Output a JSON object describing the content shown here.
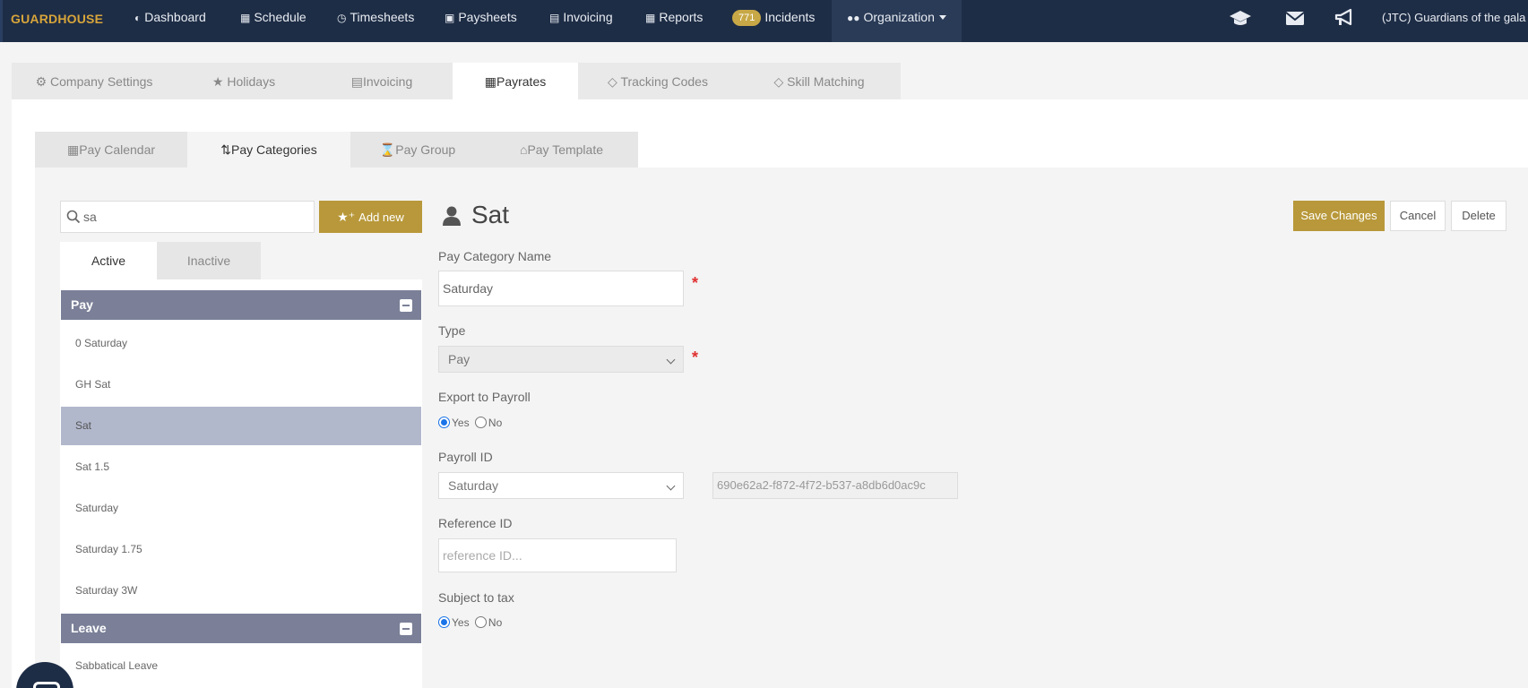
{
  "navbar": {
    "brand": "GUARDHOUSE",
    "items": [
      {
        "label": "Dashboard",
        "icon": "tachometer-icon",
        "glyph": "🚗"
      },
      {
        "label": "Schedule",
        "icon": "calendar-icon",
        "glyph": "▦"
      },
      {
        "label": "Timesheets",
        "icon": "clock-icon",
        "glyph": "◷"
      },
      {
        "label": "Paysheets",
        "icon": "money-icon",
        "glyph": "▣"
      },
      {
        "label": "Invoicing",
        "icon": "invoice-icon",
        "glyph": "▤"
      },
      {
        "label": "Reports",
        "icon": "table-icon",
        "glyph": "▦"
      },
      {
        "label": "Incidents",
        "badge": "771"
      },
      {
        "label": "Organization",
        "icon": "users-icon",
        "glyph": "👥"
      }
    ],
    "tenant": "(JTC) Guardians of the gala"
  },
  "main_tabs": [
    {
      "label": "Company Settings",
      "glyph": "⚙"
    },
    {
      "label": "Holidays",
      "glyph": "★"
    },
    {
      "label": "Invoicing",
      "glyph": "▤"
    },
    {
      "label": "Payrates",
      "glyph": "📅"
    },
    {
      "label": "Tracking Codes",
      "glyph": "◇"
    },
    {
      "label": "Skill Matching",
      "glyph": "◇"
    }
  ],
  "sub_tabs": [
    {
      "label": "Pay Calendar",
      "glyph": "▦"
    },
    {
      "label": "Pay Categories",
      "glyph": "⇅"
    },
    {
      "label": "Pay Group",
      "glyph": "⌛"
    },
    {
      "label": "Pay Template",
      "glyph": "🏛"
    }
  ],
  "search": {
    "value": "sa"
  },
  "add_new_label": "Add new",
  "list_tabs": {
    "active": "Active",
    "inactive": "Inactive"
  },
  "groups": {
    "pay": {
      "title": "Pay",
      "items": [
        "0 Saturday",
        "GH Sat",
        "Sat",
        "Sat 1.5",
        "Saturday",
        "Saturday 1.75",
        "Saturday 3W"
      ],
      "selected": "Sat"
    },
    "leave": {
      "title": "Leave",
      "items": [
        "Sabbatical Leave"
      ]
    }
  },
  "form": {
    "title": "Sat",
    "save_label": "Save Changes",
    "cancel_label": "Cancel",
    "delete_label": "Delete",
    "name_label": "Pay Category Name",
    "name_value": "Saturday",
    "required_mark": "*",
    "type_label": "Type",
    "type_value": "Pay",
    "export_label": "Export to Payroll",
    "export_value": "Yes",
    "yes_label": "Yes",
    "no_label": "No",
    "payroll_id_label": "Payroll ID",
    "payroll_id_value": "Saturday",
    "payroll_guid": "690e62a2-f872-4f72-b537-a8db6d0ac9c",
    "reference_label": "Reference ID",
    "reference_placeholder": "reference ID...",
    "tax_label": "Subject to tax",
    "tax_value": "Yes"
  },
  "colors": {
    "navbar": "#1e2d46",
    "brand": "#d7a53a",
    "accent_button": "#b8983a",
    "group_header": "#7b8098",
    "selected_row": "#b2b8cc",
    "required": "#e03030"
  }
}
